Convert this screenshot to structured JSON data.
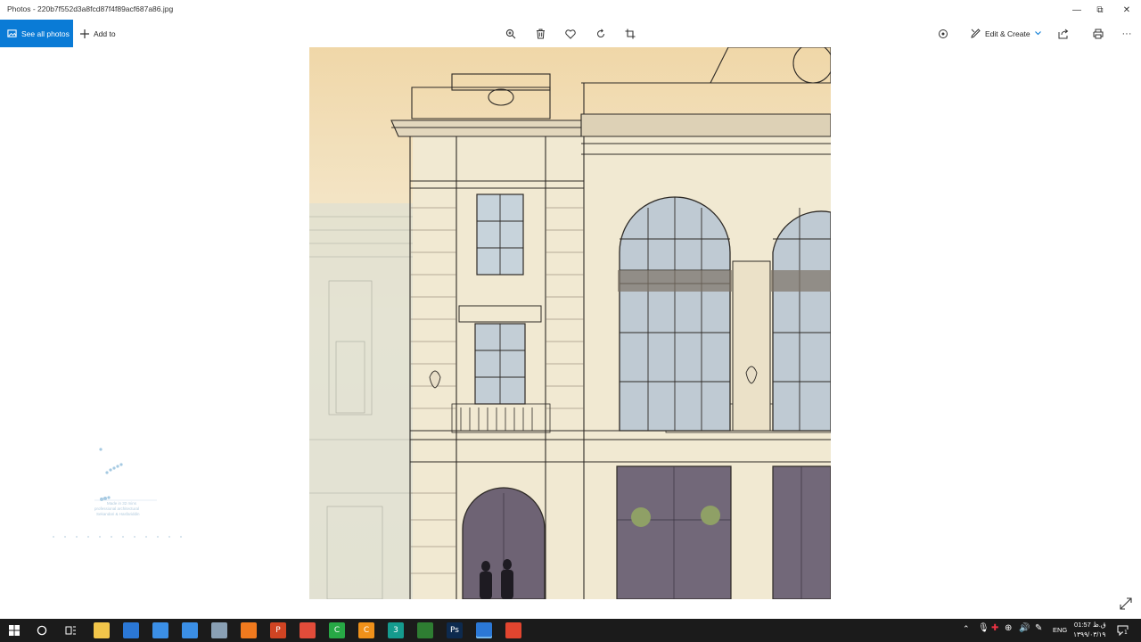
{
  "window": {
    "title": "Photos - 220b7f552d3a8fcd87f4f89acf687a86.jpg",
    "minimize_glyph": "—",
    "restore_glyph": "⧉",
    "close_glyph": "✕"
  },
  "toolbar": {
    "see_all_label": "See all photos",
    "add_to_label": "Add to",
    "edit_create_label": "Edit & Create",
    "more_glyph": "···"
  },
  "watermark": {
    "line1": "Made in 32 mins",
    "line2": "professional architectural",
    "line3": "Sekandari & Hasfariddin"
  },
  "taskbar": {
    "lang": "ENG",
    "time": "01:57 ق.ظ",
    "date": "۱۳۹۹/۰۳/۱۹",
    "notification_count": "1",
    "apps": [
      {
        "name": "file-explorer",
        "color": "#f2c64a",
        "glyph": ""
      },
      {
        "name": "store",
        "color": "#2b78d6",
        "glyph": ""
      },
      {
        "name": "mail",
        "color": "#3b8fe6",
        "glyph": ""
      },
      {
        "name": "app-blue",
        "color": "#3b8fe6",
        "glyph": ""
      },
      {
        "name": "app-gray",
        "color": "#8aa0b4",
        "glyph": ""
      },
      {
        "name": "search-app",
        "color": "#f07a1e",
        "glyph": ""
      },
      {
        "name": "powerpoint",
        "color": "#d04423",
        "glyph": "P"
      },
      {
        "name": "chrome",
        "color": "#e24c3a",
        "glyph": ""
      },
      {
        "name": "camtasia",
        "color": "#27a845",
        "glyph": "C"
      },
      {
        "name": "app-orange",
        "color": "#f0911a",
        "glyph": "C"
      },
      {
        "name": "3dsmax",
        "color": "#159b8e",
        "glyph": "3"
      },
      {
        "name": "app-green",
        "color": "#2e7d32",
        "glyph": ""
      },
      {
        "name": "photoshop",
        "color": "#0d2a4e",
        "glyph": "Ps"
      },
      {
        "name": "photos",
        "color": "#2b78d6",
        "glyph": ""
      },
      {
        "name": "recorder",
        "color": "#e2452f",
        "glyph": ""
      }
    ]
  },
  "colors": {
    "accent": "#0a7bd6",
    "taskbar": "#1b1b1b"
  }
}
